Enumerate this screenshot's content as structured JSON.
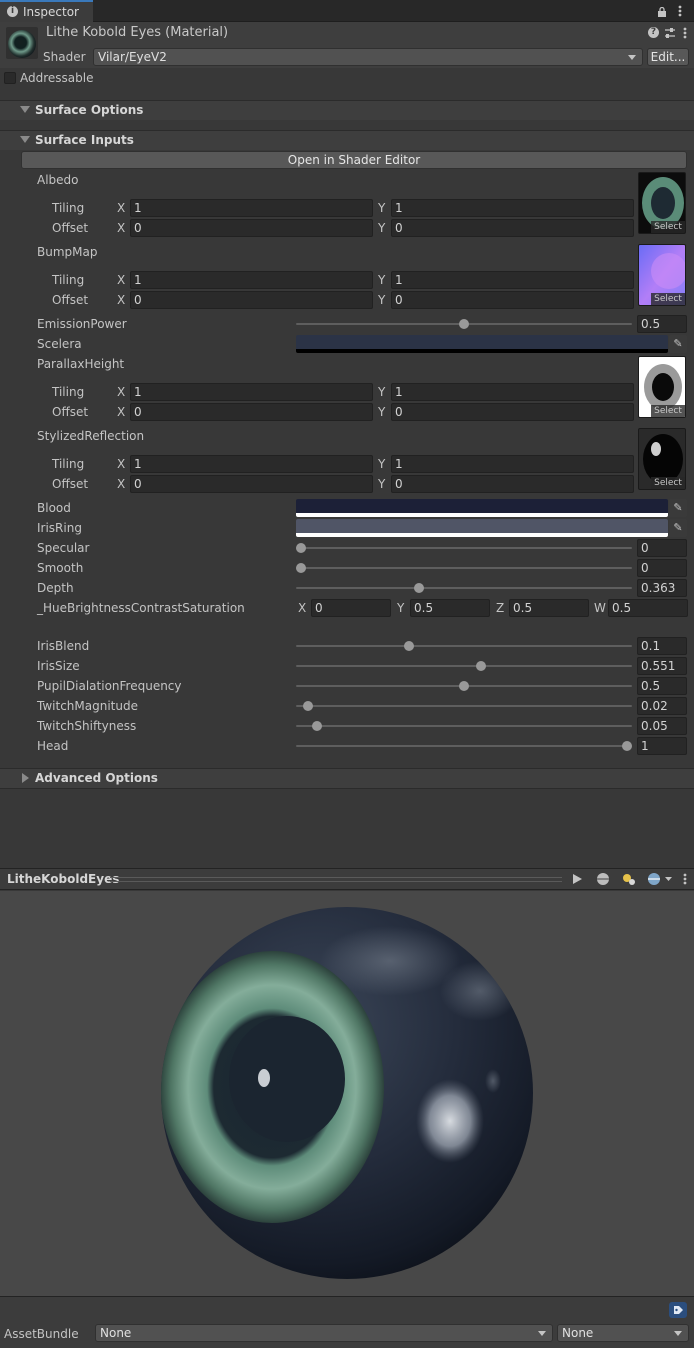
{
  "tab": {
    "label": "Inspector"
  },
  "material": {
    "title": "Lithe Kobold Eyes (Material)",
    "shader_label": "Shader",
    "shader_value": "Vilar/EyeV2",
    "edit_label": "Edit...",
    "addressable_label": "Addressable"
  },
  "sections": {
    "surface_options": "Surface Options",
    "surface_inputs": "Surface Inputs",
    "advanced_options": "Advanced Options"
  },
  "open_shader_editor": "Open in Shader Editor",
  "texture_select": "Select",
  "textures": [
    {
      "name": "Albedo",
      "tiling_x": "1",
      "tiling_y": "1",
      "offset_x": "0",
      "offset_y": "0"
    },
    {
      "name": "BumpMap",
      "tiling_x": "1",
      "tiling_y": "1",
      "offset_x": "0",
      "offset_y": "0"
    },
    {
      "name": "ParallaxHeight",
      "tiling_x": "1",
      "tiling_y": "1",
      "offset_x": "0",
      "offset_y": "0"
    },
    {
      "name": "StylizedReflection",
      "tiling_x": "1",
      "tiling_y": "1",
      "offset_x": "0",
      "offset_y": "0"
    }
  ],
  "labels": {
    "tiling": "Tiling",
    "offset": "Offset",
    "x": "X",
    "y": "Y",
    "z": "Z",
    "w": "W"
  },
  "emission": {
    "label": "EmissionPower",
    "value": "0.5",
    "fraction": 0.5
  },
  "scelera": {
    "label": "Scelera",
    "color": "#2b3346"
  },
  "blood": {
    "label": "Blood",
    "color": "#1c2037"
  },
  "iris_ring": {
    "label": "IrisRing",
    "color": "#505566"
  },
  "sliders1": [
    {
      "label": "Specular",
      "value": "0",
      "fraction": 0.0
    },
    {
      "label": "Smooth",
      "value": "0",
      "fraction": 0.0
    },
    {
      "label": "Depth",
      "value": "0.363",
      "fraction": 0.363
    }
  ],
  "hbcs": {
    "label": "_HueBrightnessContrastSaturation",
    "x": "0",
    "y": "0.5",
    "z": "0.5",
    "w": "0.5"
  },
  "sliders2": [
    {
      "label": "IrisBlend",
      "value": "0.1",
      "fraction": 0.33
    },
    {
      "label": "IrisSize",
      "value": "0.551",
      "fraction": 0.551
    },
    {
      "label": "PupilDialationFrequency",
      "value": "0.5",
      "fraction": 0.5
    },
    {
      "label": "TwitchMagnitude",
      "value": "0.02",
      "fraction": 0.02
    },
    {
      "label": "TwitchShiftyness",
      "value": "0.05",
      "fraction": 0.05
    },
    {
      "label": "Head",
      "value": "1",
      "fraction": 1.0
    }
  ],
  "preview": {
    "title": "LitheKoboldEyes"
  },
  "asset_bundle": {
    "label": "AssetBundle",
    "name": "None",
    "variant": "None"
  }
}
